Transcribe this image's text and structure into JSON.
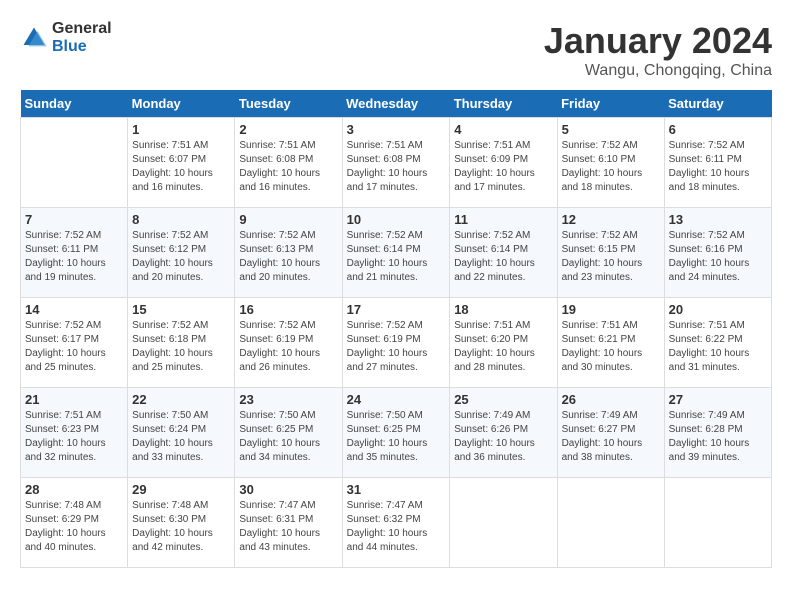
{
  "header": {
    "logo_general": "General",
    "logo_blue": "Blue",
    "month_title": "January 2024",
    "location": "Wangu, Chongqing, China"
  },
  "weekdays": [
    "Sunday",
    "Monday",
    "Tuesday",
    "Wednesday",
    "Thursday",
    "Friday",
    "Saturday"
  ],
  "weeks": [
    [
      {
        "day": "",
        "info": ""
      },
      {
        "day": "1",
        "info": "Sunrise: 7:51 AM\nSunset: 6:07 PM\nDaylight: 10 hours\nand 16 minutes."
      },
      {
        "day": "2",
        "info": "Sunrise: 7:51 AM\nSunset: 6:08 PM\nDaylight: 10 hours\nand 16 minutes."
      },
      {
        "day": "3",
        "info": "Sunrise: 7:51 AM\nSunset: 6:08 PM\nDaylight: 10 hours\nand 17 minutes."
      },
      {
        "day": "4",
        "info": "Sunrise: 7:51 AM\nSunset: 6:09 PM\nDaylight: 10 hours\nand 17 minutes."
      },
      {
        "day": "5",
        "info": "Sunrise: 7:52 AM\nSunset: 6:10 PM\nDaylight: 10 hours\nand 18 minutes."
      },
      {
        "day": "6",
        "info": "Sunrise: 7:52 AM\nSunset: 6:11 PM\nDaylight: 10 hours\nand 18 minutes."
      }
    ],
    [
      {
        "day": "7",
        "info": "Sunrise: 7:52 AM\nSunset: 6:11 PM\nDaylight: 10 hours\nand 19 minutes."
      },
      {
        "day": "8",
        "info": "Sunrise: 7:52 AM\nSunset: 6:12 PM\nDaylight: 10 hours\nand 20 minutes."
      },
      {
        "day": "9",
        "info": "Sunrise: 7:52 AM\nSunset: 6:13 PM\nDaylight: 10 hours\nand 20 minutes."
      },
      {
        "day": "10",
        "info": "Sunrise: 7:52 AM\nSunset: 6:14 PM\nDaylight: 10 hours\nand 21 minutes."
      },
      {
        "day": "11",
        "info": "Sunrise: 7:52 AM\nSunset: 6:14 PM\nDaylight: 10 hours\nand 22 minutes."
      },
      {
        "day": "12",
        "info": "Sunrise: 7:52 AM\nSunset: 6:15 PM\nDaylight: 10 hours\nand 23 minutes."
      },
      {
        "day": "13",
        "info": "Sunrise: 7:52 AM\nSunset: 6:16 PM\nDaylight: 10 hours\nand 24 minutes."
      }
    ],
    [
      {
        "day": "14",
        "info": "Sunrise: 7:52 AM\nSunset: 6:17 PM\nDaylight: 10 hours\nand 25 minutes."
      },
      {
        "day": "15",
        "info": "Sunrise: 7:52 AM\nSunset: 6:18 PM\nDaylight: 10 hours\nand 25 minutes."
      },
      {
        "day": "16",
        "info": "Sunrise: 7:52 AM\nSunset: 6:19 PM\nDaylight: 10 hours\nand 26 minutes."
      },
      {
        "day": "17",
        "info": "Sunrise: 7:52 AM\nSunset: 6:19 PM\nDaylight: 10 hours\nand 27 minutes."
      },
      {
        "day": "18",
        "info": "Sunrise: 7:51 AM\nSunset: 6:20 PM\nDaylight: 10 hours\nand 28 minutes."
      },
      {
        "day": "19",
        "info": "Sunrise: 7:51 AM\nSunset: 6:21 PM\nDaylight: 10 hours\nand 30 minutes."
      },
      {
        "day": "20",
        "info": "Sunrise: 7:51 AM\nSunset: 6:22 PM\nDaylight: 10 hours\nand 31 minutes."
      }
    ],
    [
      {
        "day": "21",
        "info": "Sunrise: 7:51 AM\nSunset: 6:23 PM\nDaylight: 10 hours\nand 32 minutes."
      },
      {
        "day": "22",
        "info": "Sunrise: 7:50 AM\nSunset: 6:24 PM\nDaylight: 10 hours\nand 33 minutes."
      },
      {
        "day": "23",
        "info": "Sunrise: 7:50 AM\nSunset: 6:25 PM\nDaylight: 10 hours\nand 34 minutes."
      },
      {
        "day": "24",
        "info": "Sunrise: 7:50 AM\nSunset: 6:25 PM\nDaylight: 10 hours\nand 35 minutes."
      },
      {
        "day": "25",
        "info": "Sunrise: 7:49 AM\nSunset: 6:26 PM\nDaylight: 10 hours\nand 36 minutes."
      },
      {
        "day": "26",
        "info": "Sunrise: 7:49 AM\nSunset: 6:27 PM\nDaylight: 10 hours\nand 38 minutes."
      },
      {
        "day": "27",
        "info": "Sunrise: 7:49 AM\nSunset: 6:28 PM\nDaylight: 10 hours\nand 39 minutes."
      }
    ],
    [
      {
        "day": "28",
        "info": "Sunrise: 7:48 AM\nSunset: 6:29 PM\nDaylight: 10 hours\nand 40 minutes."
      },
      {
        "day": "29",
        "info": "Sunrise: 7:48 AM\nSunset: 6:30 PM\nDaylight: 10 hours\nand 42 minutes."
      },
      {
        "day": "30",
        "info": "Sunrise: 7:47 AM\nSunset: 6:31 PM\nDaylight: 10 hours\nand 43 minutes."
      },
      {
        "day": "31",
        "info": "Sunrise: 7:47 AM\nSunset: 6:32 PM\nDaylight: 10 hours\nand 44 minutes."
      },
      {
        "day": "",
        "info": ""
      },
      {
        "day": "",
        "info": ""
      },
      {
        "day": "",
        "info": ""
      }
    ]
  ]
}
